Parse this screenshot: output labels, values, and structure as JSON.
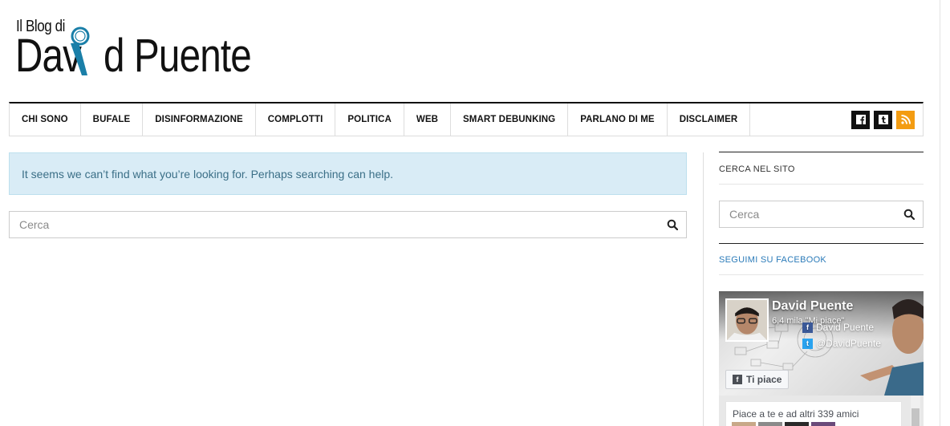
{
  "logo": {
    "small_text": "Il Blog di",
    "big_text_left": "Dav",
    "big_text_right": "d Puente"
  },
  "nav": {
    "items": [
      {
        "label": "CHI SONO"
      },
      {
        "label": "BUFALE"
      },
      {
        "label": "DISINFORMAZIONE"
      },
      {
        "label": "COMPLOTTI"
      },
      {
        "label": "POLITICA"
      },
      {
        "label": "WEB"
      },
      {
        "label": "SMART DEBUNKING"
      },
      {
        "label": "PARLANO DI ME"
      },
      {
        "label": "DISCLAIMER"
      }
    ],
    "social": [
      {
        "icon": "facebook-icon"
      },
      {
        "icon": "tumblr-icon"
      },
      {
        "icon": "rss-icon"
      }
    ]
  },
  "main": {
    "alert_text": "It seems we can’t find what you’re looking for. Perhaps searching can help.",
    "search_placeholder": "Cerca"
  },
  "sidebar": {
    "search_title": "CERCA NEL SITO",
    "search_placeholder": "Cerca",
    "facebook_title": "SEGUIMI SU FACEBOOK",
    "fb_widget": {
      "page_name": "David Puente",
      "likes": "6,4 mila \"Mi piace\"",
      "fb_handle": "David Puente",
      "twitter_handle": "@DavidPuente",
      "like_button": "Ti piace",
      "friends_text": "Piace a te e ad altri 339 amici"
    }
  },
  "colors": {
    "accent_blue": "#2b7bb9",
    "alert_bg": "#d9ecf6",
    "rss_orange": "#f39c12",
    "magnifier_blue": "#1a7fa8"
  }
}
